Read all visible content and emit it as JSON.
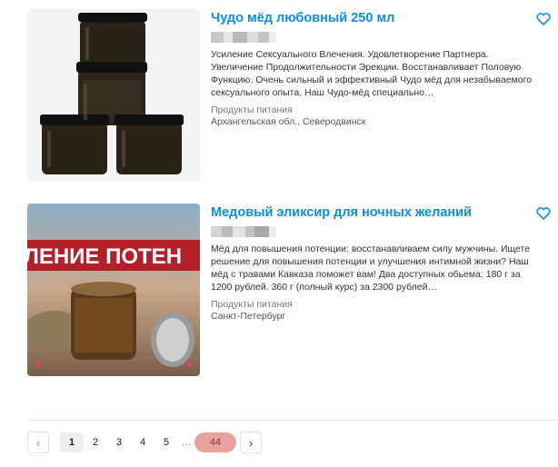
{
  "listings": [
    {
      "title": "Чудо мёд любовный 250 мл",
      "description": "Усиление Сексуального Влечения. Удовлетворение Партнера. Увеличение Продолжительности Эрекции. Восстанавливает Половую Функцию. Очень сильный и эффективный Чудо мёд для незабываемого сексуального опыта. Наш Чудо-мёд специально…",
      "category": "Продукты питания",
      "location": "Архангельская обл., Северодвинск",
      "image": "honey-jars-stack",
      "favorite_icon": "heart-outline-icon"
    },
    {
      "title": "Медовый эликсир для ночных желаний",
      "description": "Мёд для повышения потенции: восстанавливаем силу мужчины. Ищете решение для повышения потенции и улучшения интимной жизни? Наш мёд с травами Кавказа поможет вам! Два доступных обьема: 180 г за 1200 рублей. 360 г (полный курс) за 2300 рублей…",
      "category": "Продукты питания",
      "location": "Санкт-Петербург",
      "image": "honey-jar-banner",
      "image_text": "ЛЕНИЕ ПОТЕН",
      "favorite_icon": "heart-outline-icon"
    }
  ],
  "pagination": {
    "prev": "‹",
    "pages": [
      "1",
      "2",
      "3",
      "4",
      "5"
    ],
    "dots": "…",
    "last": "44",
    "next": "›",
    "current": "1"
  },
  "colors": {
    "accent": "#0a8ee6",
    "highlight": "#e8a29e"
  }
}
